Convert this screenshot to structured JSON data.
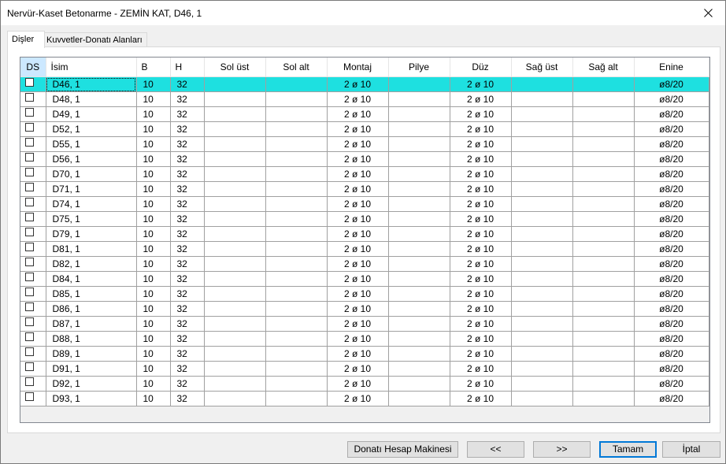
{
  "window": {
    "title": "Nervür-Kaset Betonarme - ZEMİN KAT, D46, 1"
  },
  "tabs": [
    {
      "label": "Dişler"
    },
    {
      "label": "Kuvvetler-Donatı Alanları"
    }
  ],
  "grid": {
    "columns": [
      "DS",
      "İsim",
      "B",
      "H",
      "Sol üst",
      "Sol alt",
      "Montaj",
      "Pilye",
      "Düz",
      "Sağ üst",
      "Sağ alt",
      "Enine"
    ],
    "rows": [
      {
        "name": "D46, 1",
        "b": "10",
        "h": "32",
        "montaj": "2 ø 10",
        "duz": "2 ø 10",
        "enine": "ø8/20"
      },
      {
        "name": "D48, 1",
        "b": "10",
        "h": "32",
        "montaj": "2 ø 10",
        "duz": "2 ø 10",
        "enine": "ø8/20"
      },
      {
        "name": "D49, 1",
        "b": "10",
        "h": "32",
        "montaj": "2 ø 10",
        "duz": "2 ø 10",
        "enine": "ø8/20"
      },
      {
        "name": "D52, 1",
        "b": "10",
        "h": "32",
        "montaj": "2 ø 10",
        "duz": "2 ø 10",
        "enine": "ø8/20"
      },
      {
        "name": "D55, 1",
        "b": "10",
        "h": "32",
        "montaj": "2 ø 10",
        "duz": "2 ø 10",
        "enine": "ø8/20"
      },
      {
        "name": "D56, 1",
        "b": "10",
        "h": "32",
        "montaj": "2 ø 10",
        "duz": "2 ø 10",
        "enine": "ø8/20"
      },
      {
        "name": "D70, 1",
        "b": "10",
        "h": "32",
        "montaj": "2 ø 10",
        "duz": "2 ø 10",
        "enine": "ø8/20"
      },
      {
        "name": "D71, 1",
        "b": "10",
        "h": "32",
        "montaj": "2 ø 10",
        "duz": "2 ø 10",
        "enine": "ø8/20"
      },
      {
        "name": "D74, 1",
        "b": "10",
        "h": "32",
        "montaj": "2 ø 10",
        "duz": "2 ø 10",
        "enine": "ø8/20"
      },
      {
        "name": "D75, 1",
        "b": "10",
        "h": "32",
        "montaj": "2 ø 10",
        "duz": "2 ø 10",
        "enine": "ø8/20"
      },
      {
        "name": "D79, 1",
        "b": "10",
        "h": "32",
        "montaj": "2 ø 10",
        "duz": "2 ø 10",
        "enine": "ø8/20"
      },
      {
        "name": "D81, 1",
        "b": "10",
        "h": "32",
        "montaj": "2 ø 10",
        "duz": "2 ø 10",
        "enine": "ø8/20"
      },
      {
        "name": "D82, 1",
        "b": "10",
        "h": "32",
        "montaj": "2 ø 10",
        "duz": "2 ø 10",
        "enine": "ø8/20"
      },
      {
        "name": "D84, 1",
        "b": "10",
        "h": "32",
        "montaj": "2 ø 10",
        "duz": "2 ø 10",
        "enine": "ø8/20"
      },
      {
        "name": "D85, 1",
        "b": "10",
        "h": "32",
        "montaj": "2 ø 10",
        "duz": "2 ø 10",
        "enine": "ø8/20"
      },
      {
        "name": "D86, 1",
        "b": "10",
        "h": "32",
        "montaj": "2 ø 10",
        "duz": "2 ø 10",
        "enine": "ø8/20"
      },
      {
        "name": "D87, 1",
        "b": "10",
        "h": "32",
        "montaj": "2 ø 10",
        "duz": "2 ø 10",
        "enine": "ø8/20"
      },
      {
        "name": "D88, 1",
        "b": "10",
        "h": "32",
        "montaj": "2 ø 10",
        "duz": "2 ø 10",
        "enine": "ø8/20"
      },
      {
        "name": "D89, 1",
        "b": "10",
        "h": "32",
        "montaj": "2 ø 10",
        "duz": "2 ø 10",
        "enine": "ø8/20"
      },
      {
        "name": "D91, 1",
        "b": "10",
        "h": "32",
        "montaj": "2 ø 10",
        "duz": "2 ø 10",
        "enine": "ø8/20"
      },
      {
        "name": "D92, 1",
        "b": "10",
        "h": "32",
        "montaj": "2 ø 10",
        "duz": "2 ø 10",
        "enine": "ø8/20"
      },
      {
        "name": "D93, 1",
        "b": "10",
        "h": "32",
        "montaj": "2 ø 10",
        "duz": "2 ø 10",
        "enine": "ø8/20"
      }
    ],
    "selected_row": 0,
    "selected_color": "#1ee0e0"
  },
  "buttons": {
    "calc": "Donatı Hesap Makinesi",
    "prev": "<<",
    "next": ">>",
    "ok": "Tamam",
    "cancel": "İptal"
  },
  "icons": {
    "close": "close-icon",
    "checkbox": "checkbox-icon"
  }
}
